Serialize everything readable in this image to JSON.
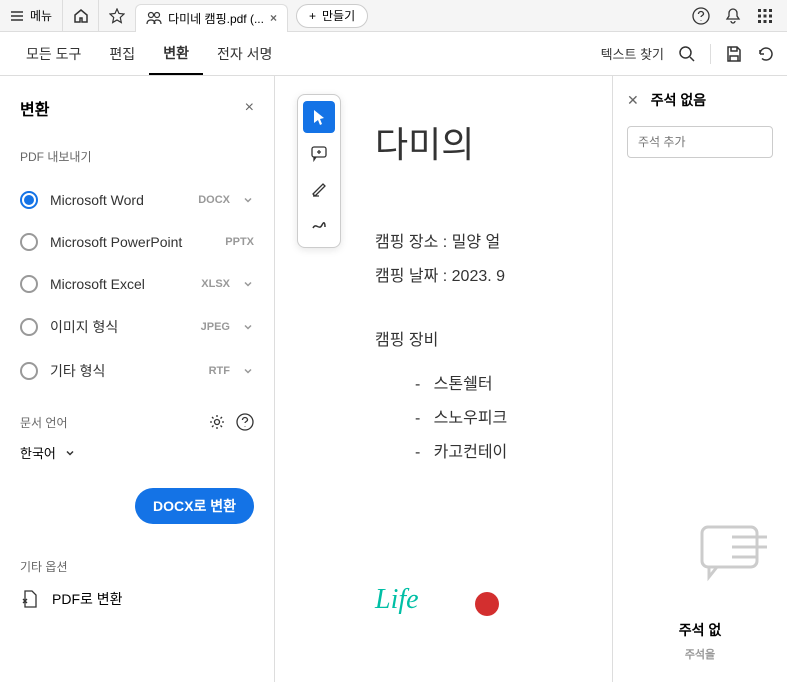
{
  "topbar": {
    "menu_label": "메뉴",
    "tab_title": "다미네 캠핑.pdf (...",
    "create_label": "만들기"
  },
  "tooltabs": {
    "all_tools": "모든 도구",
    "edit": "편집",
    "convert": "변환",
    "sign": "전자 서명",
    "search_text": "텍스트 찾기"
  },
  "panel": {
    "title": "변환",
    "export_label": "PDF 내보내기",
    "formats": [
      {
        "name": "Microsoft Word",
        "ext": "DOCX"
      },
      {
        "name": "Microsoft PowerPoint",
        "ext": "PPTX"
      },
      {
        "name": "Microsoft Excel",
        "ext": "XLSX"
      },
      {
        "name": "이미지 형식",
        "ext": "JPEG"
      },
      {
        "name": "기타 형식",
        "ext": "RTF"
      }
    ],
    "lang_label": "문서 언어",
    "lang_value": "한국어",
    "convert_btn": "DOCX로 변환",
    "other_label": "기타 옵션",
    "pdf_convert": "PDF로 변환"
  },
  "doc": {
    "title": "다미의",
    "place": "캠핑 장소 : 밀양 얼",
    "date": "캠핑 날짜 : 2023. 9",
    "equip_label": "캠핑 장비",
    "items": [
      "스톤쉘터",
      "스노우피크",
      "카고컨테이"
    ],
    "life": "Life"
  },
  "rpanel": {
    "title": "주석 없음",
    "placeholder": "주석 추가",
    "bottom": "주석 없",
    "bottom_sub": "주석을"
  }
}
